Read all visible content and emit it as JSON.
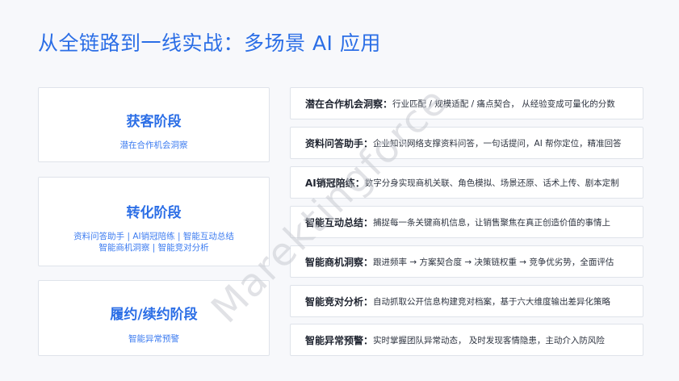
{
  "page_title": "从全链路到一线实战：多场景 AI 应用",
  "stages": [
    {
      "title": "获客阶段",
      "lines": [
        "潜在合作机会洞察"
      ]
    },
    {
      "title": "转化阶段",
      "lines": [
        "资料问答助手 | AI销冠陪练 | 智能互动总结",
        "智能商机洞察 | 智能竞对分析"
      ]
    },
    {
      "title": "履约/续约阶段",
      "lines": [
        "智能异常预警"
      ]
    }
  ],
  "features": [
    {
      "name": "潜在合作机会洞察：",
      "desc": "行业匹配 / 规模适配 / 痛点契合， 从经验变成可量化的分数"
    },
    {
      "name": "资料问答助手：",
      "desc": "企业知识网络支撑资料问答，一句话提问，AI 帮你定位，精准回答"
    },
    {
      "name": "AI销冠陪练：",
      "desc": "数字分身实现商机关联、角色模拟、场景还原、话术上传、剧本定制"
    },
    {
      "name": "智能互动总结：",
      "desc": "捕捉每一条关键商机信息，让销售聚焦在真正创造价值的事情上"
    },
    {
      "name": "智能商机洞察：",
      "desc": "跟进频率 → 方案契合度 → 决策链权重 → 竞争优劣势，全面评估"
    },
    {
      "name": "智能竞对分析：",
      "desc": "自动抓取公开信息构建竞对档案，基于六大维度输出差异化策略"
    },
    {
      "name": "智能异常预警：",
      "desc": "实时掌握团队异常动态， 及时发现客情隐患，主动介入防风险"
    }
  ],
  "watermark": "Marektingforce"
}
